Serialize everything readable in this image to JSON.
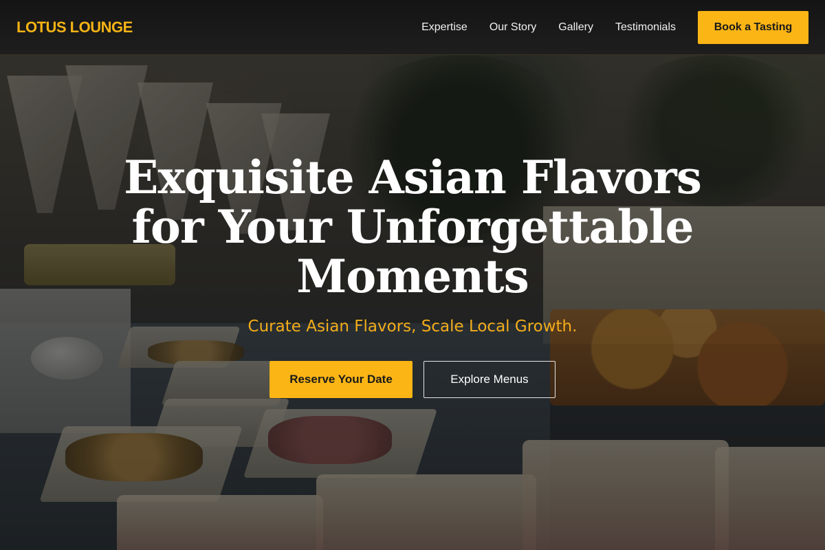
{
  "header": {
    "logo": "LOTUS LOUNGE",
    "nav": [
      {
        "label": "Expertise"
      },
      {
        "label": "Our Story"
      },
      {
        "label": "Gallery"
      },
      {
        "label": "Testimonials"
      }
    ],
    "cta_label": "Book a Tasting"
  },
  "hero": {
    "headline": "Exquisite Asian Flavors for Your Unforgettable Moments",
    "tagline": "Curate Asian Flavors, Scale Local Growth.",
    "primary_button": "Reserve Your Date",
    "secondary_button": "Explore Menus"
  },
  "colors": {
    "accent": "#fbb515",
    "header_bg": "#1a1a1a",
    "headline": "#ffffff",
    "tagline": "#f4ad1a"
  }
}
